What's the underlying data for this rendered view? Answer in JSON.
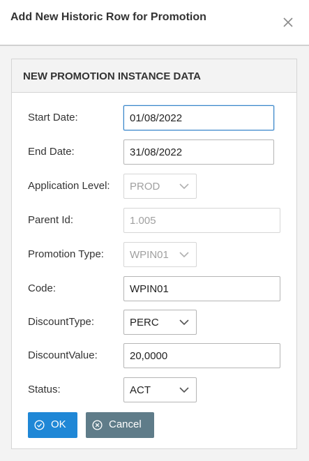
{
  "dialog": {
    "title": "Add New Historic Row for Promotion",
    "close_icon": "close-icon"
  },
  "panel": {
    "header": "NEW PROMOTION INSTANCE DATA"
  },
  "form": {
    "start_date": {
      "label": "Start Date:",
      "value": "01/08/2022"
    },
    "end_date": {
      "label": "End Date:",
      "value": "31/08/2022"
    },
    "application_level": {
      "label": "Application Level:",
      "value": "PROD"
    },
    "parent_id": {
      "label": "Parent Id:",
      "value": "1.005"
    },
    "promotion_type": {
      "label": "Promotion Type:",
      "value": "WPIN01"
    },
    "code": {
      "label": "Code:",
      "value": "WPIN01"
    },
    "discount_type": {
      "label": "DiscountType:",
      "value": "PERC"
    },
    "discount_value": {
      "label": "DiscountValue:",
      "value": "20,0000"
    },
    "status": {
      "label": "Status:",
      "value": "ACT"
    }
  },
  "buttons": {
    "ok_label": "OK",
    "cancel_label": "Cancel"
  },
  "colors": {
    "ok_button": "#1f87d6",
    "cancel_button": "#5f7c89",
    "focus_border": "#3a86c8"
  }
}
